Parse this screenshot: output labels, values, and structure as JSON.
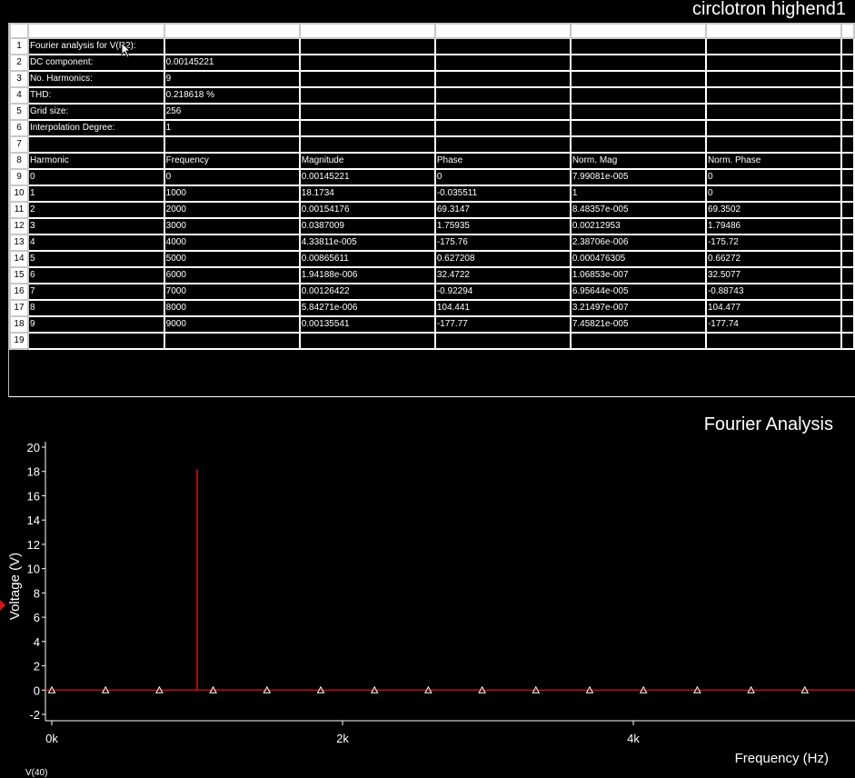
{
  "window": {
    "title": "circlotron highend1"
  },
  "sheet": {
    "row_numbers": [
      "1",
      "2",
      "3",
      "4",
      "5",
      "6",
      "7",
      "8",
      "9",
      "10",
      "11",
      "12",
      "13",
      "14",
      "15",
      "16",
      "17",
      "18",
      "19"
    ],
    "rows": [
      [
        "Fourier analysis for V(R2):",
        "",
        "",
        "",
        "",
        ""
      ],
      [
        "DC component:",
        "0.00145221",
        "",
        "",
        "",
        ""
      ],
      [
        "No. Harmonics:",
        "9",
        "",
        "",
        "",
        ""
      ],
      [
        "THD:",
        "0.218618 %",
        "",
        "",
        "",
        ""
      ],
      [
        "Grid size:",
        "256",
        "",
        "",
        "",
        ""
      ],
      [
        "Interpolation Degree:",
        "1",
        "",
        "",
        "",
        ""
      ],
      [
        "",
        "",
        "",
        "",
        "",
        ""
      ],
      [
        "Harmonic",
        "Frequency",
        "Magnitude",
        "Phase",
        "Norm. Mag",
        "Norm. Phase"
      ],
      [
        "0",
        "0",
        "0.00145221",
        "0",
        "7.99081e-005",
        "0"
      ],
      [
        "1",
        "1000",
        "18.1734",
        "-0.035511",
        "1",
        "0"
      ],
      [
        "2",
        "2000",
        "0.00154176",
        "69.3147",
        "8.48357e-005",
        "69.3502"
      ],
      [
        "3",
        "3000",
        "0.0387009",
        "1.75935",
        "0.00212953",
        "1.79486"
      ],
      [
        "4",
        "4000",
        "4.33811e-005",
        "-175.76",
        "2.38706e-006",
        "-175.72"
      ],
      [
        "5",
        "5000",
        "0.00865611",
        "0.627208",
        "0.000476305",
        "0.66272"
      ],
      [
        "6",
        "6000",
        "1.94188e-006",
        "32.4722",
        "1.06853e-007",
        "32.5077"
      ],
      [
        "7",
        "7000",
        "0.00126422",
        "-0.92294",
        "6.95644e-005",
        "-0.88743"
      ],
      [
        "8",
        "8000",
        "5.84271e-006",
        "104.441",
        "3.21497e-007",
        "104.477"
      ],
      [
        "9",
        "9000",
        "0.00135541",
        "-177.77",
        "7.45821e-005",
        "-177.74"
      ],
      [
        "",
        "",
        "",
        "",
        "",
        ""
      ]
    ]
  },
  "plot": {
    "title": "Fourier Analysis",
    "footer_label": "V(40)",
    "colors": {
      "trace": "#e01010",
      "marker": "#ffffff",
      "axis": "#ffffff"
    }
  },
  "chart_data": {
    "type": "bar",
    "title": "Fourier Analysis",
    "xlabel": "Frequency (Hz)",
    "ylabel": "Voltage (V)",
    "xlim": [
      0,
      5800
    ],
    "ylim": [
      -2,
      20
    ],
    "yticks": [
      -2,
      0,
      2,
      4,
      6,
      8,
      10,
      12,
      14,
      16,
      18,
      20
    ],
    "xticks": [
      0,
      2000,
      4000
    ],
    "xtick_labels": [
      "0k",
      "2k",
      "4k"
    ],
    "grid": false,
    "series": [
      {
        "x": [
          1000
        ],
        "values": [
          18.1734
        ]
      }
    ],
    "markers_x": [
      0,
      370,
      740,
      1110,
      1480,
      1850,
      2220,
      2590,
      2960,
      3330,
      3700,
      4070,
      4440,
      4810,
      5180
    ]
  }
}
